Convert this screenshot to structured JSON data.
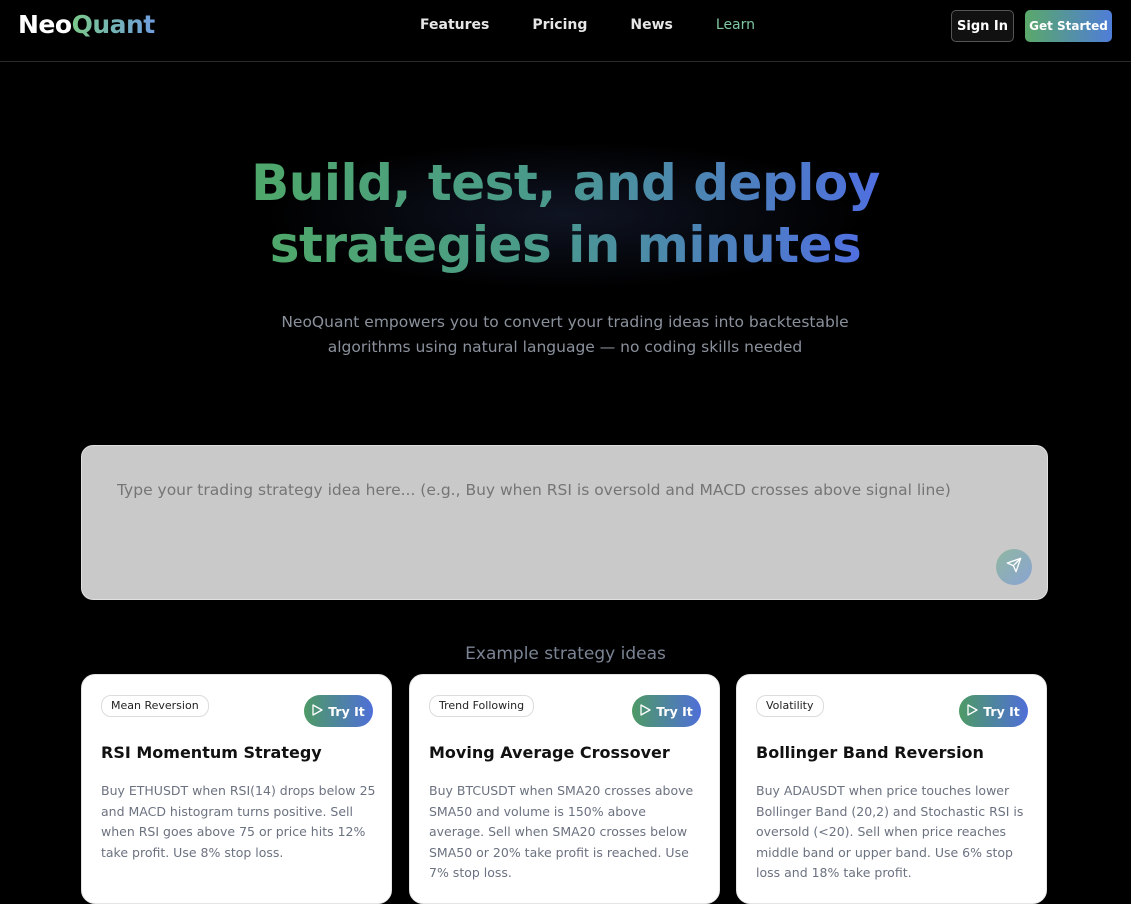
{
  "header": {
    "logo_part1": "Neo",
    "logo_part2": "Quant",
    "nav": [
      {
        "label": "Features"
      },
      {
        "label": "Pricing"
      },
      {
        "label": "News"
      },
      {
        "label": "Learn",
        "active": true
      }
    ],
    "signin_label": "Sign In",
    "start_label": "Get Started"
  },
  "hero": {
    "title_line1": "Build, test, and deploy",
    "title_line2": "strategies in minutes",
    "subtitle": "NeoQuant empowers you to convert your trading ideas into backtestable algorithms using natural language — no coding skills needed"
  },
  "prompt": {
    "placeholder": "Type your trading strategy idea here... (e.g., Buy when RSI is oversold and MACD crosses above signal line)",
    "send_icon": "send-icon"
  },
  "examples": {
    "title": "Example strategy ideas",
    "cards": [
      {
        "tag": "Mean Reversion",
        "try_label": "Try It",
        "title": "RSI Momentum Strategy",
        "desc": "Buy ETHUSDT when RSI(14) drops below 25 and MACD histogram turns positive. Sell when RSI goes above 75 or price hits 12% take profit. Use 8% stop loss."
      },
      {
        "tag": "Trend Following",
        "try_label": "Try It",
        "title": "Moving Average Crossover",
        "desc": "Buy BTCUSDT when SMA20 crosses above SMA50 and volume is 150% above average. Sell when SMA20 crosses below SMA50 or 20% take profit is reached. Use 7% stop loss."
      },
      {
        "tag": "Volatility",
        "try_label": "Try It",
        "title": "Bollinger Band Reversion",
        "desc": "Buy ADAUSDT when price touches lower Bollinger Band (20,2) and Stochastic RSI is oversold (<20). Sell when price reaches middle band or upper band. Use 6% stop loss and 18% take profit."
      }
    ]
  },
  "colors": {
    "accent_green": "#4fa86a",
    "accent_blue": "#4f6fe0",
    "background": "#000000"
  }
}
